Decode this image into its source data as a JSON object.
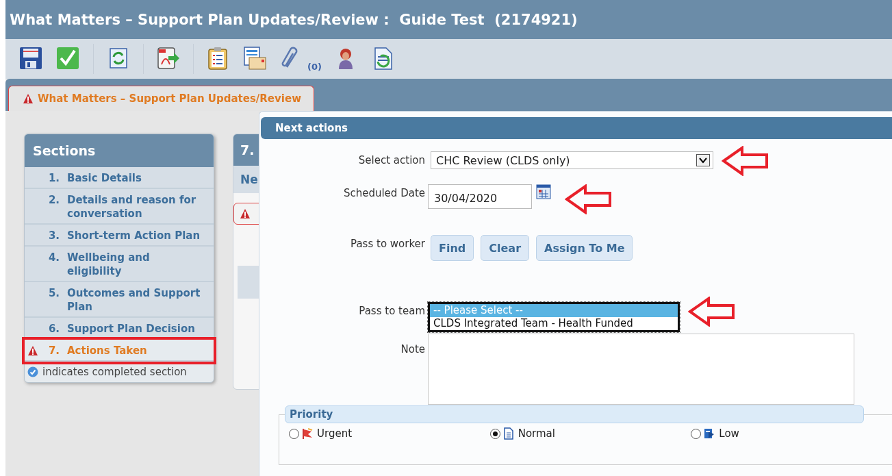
{
  "window": {
    "title": "What Matters – Support Plan Updates/Review :  Guide Test  (2174921)"
  },
  "toolbar": {
    "attachment_count": "(0)"
  },
  "tab": {
    "label": "What Matters – Support Plan Updates/Review",
    "selected": true,
    "warning": true
  },
  "sections": {
    "title": "Sections",
    "items": [
      {
        "number": "1.",
        "label": "Basic Details",
        "warning": false,
        "highlighted": false
      },
      {
        "number": "2.",
        "label": "Details and reason for conversation",
        "warning": false,
        "highlighted": false
      },
      {
        "number": "3.",
        "label": "Short-term Action Plan",
        "warning": false,
        "highlighted": false
      },
      {
        "number": "4.",
        "label": "Wellbeing and eligibility",
        "warning": false,
        "highlighted": false
      },
      {
        "number": "5.",
        "label": "Outcomes and Support Plan",
        "warning": false,
        "highlighted": false
      },
      {
        "number": "6.",
        "label": "Support Plan Decision",
        "warning": false,
        "highlighted": false
      },
      {
        "number": "7.",
        "label": "Actions Taken",
        "warning": true,
        "highlighted": true
      }
    ],
    "legend": "indicates completed section"
  },
  "background_panel": {
    "title": "7.",
    "subtitle": "Ne"
  },
  "dialog": {
    "title": "Next actions",
    "select_action": {
      "label": "Select action",
      "value": "CHC Review (CLDS only)",
      "annotated": true
    },
    "scheduled_date": {
      "label": "Scheduled Date",
      "value": "30/04/2020",
      "annotated": true
    },
    "pass_to_worker": {
      "label": "Pass to worker",
      "buttons": [
        "Find",
        "Clear",
        "Assign To Me"
      ]
    },
    "pass_to_team": {
      "label": "Pass to team",
      "annotated": true,
      "options": [
        {
          "label": "-- Please Select --",
          "selected": true
        },
        {
          "label": "CLDS Integrated Team - Health Funded",
          "selected": false
        }
      ]
    },
    "note": {
      "label": "Note"
    },
    "priority": {
      "title": "Priority",
      "options": [
        {
          "kind": "urgent",
          "label": "Urgent",
          "selected": false
        },
        {
          "kind": "normal",
          "label": "Normal",
          "selected": true
        },
        {
          "kind": "low",
          "label": "Low",
          "selected": false
        }
      ]
    }
  }
}
